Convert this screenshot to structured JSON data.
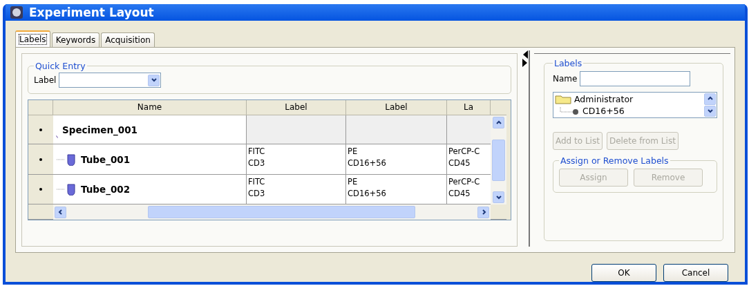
{
  "window": {
    "title": "Experiment Layout"
  },
  "tabs": [
    {
      "label": "Labels",
      "selected": true
    },
    {
      "label": "Keywords",
      "selected": false
    },
    {
      "label": "Acquisition",
      "selected": false
    }
  ],
  "quick_entry": {
    "title": "Quick Entry",
    "label": "Label"
  },
  "table": {
    "columns": [
      "Name",
      "Label",
      "Label",
      "La"
    ],
    "rows": [
      {
        "kind": "specimen",
        "name": "Specimen_001",
        "cells": [
          [],
          [],
          []
        ]
      },
      {
        "kind": "tube",
        "name": "Tube_001",
        "cells": [
          [
            "FITC",
            "CD3"
          ],
          [
            "PE",
            "CD16+56"
          ],
          [
            "PerCP-C",
            "CD45"
          ]
        ]
      },
      {
        "kind": "tube",
        "name": "Tube_002",
        "cells": [
          [
            "FITC",
            "CD3"
          ],
          [
            "PE",
            "CD16+56"
          ],
          [
            "PerCP-C",
            "CD45"
          ]
        ]
      }
    ]
  },
  "labels_panel": {
    "title": "Labels",
    "name_label": "Name",
    "tree": [
      {
        "label": "Administrator",
        "children": [
          {
            "label": "CD16+56"
          }
        ]
      }
    ],
    "buttons": [
      {
        "label": "Add to List",
        "disabled": true
      },
      {
        "label": "Delete from List",
        "disabled": true
      }
    ],
    "assign_group": {
      "title": "Assign or Remove Labels",
      "buttons": [
        {
          "label": "Assign",
          "disabled": true
        },
        {
          "label": "Remove",
          "disabled": true
        }
      ]
    }
  },
  "buttons": [
    "OK",
    "Cancel"
  ]
}
